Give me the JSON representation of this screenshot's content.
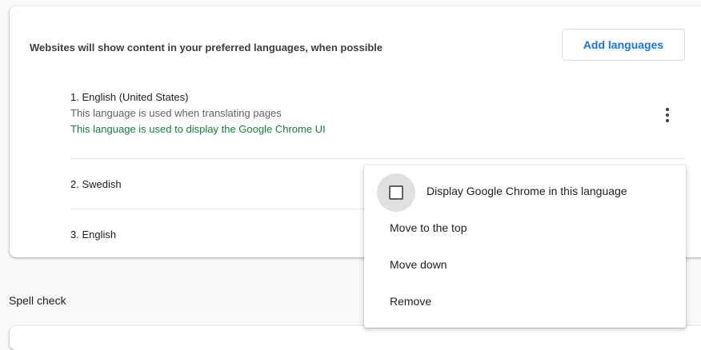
{
  "languages_card": {
    "header": "Websites will show content in your preferred languages, when possible",
    "add_button_label": "Add languages",
    "languages": [
      {
        "name": "1. English (United States)",
        "note": "This language is used when translating pages",
        "ui_note": "This language is used to display the Google Chrome UI"
      },
      {
        "name": "2. Swedish"
      },
      {
        "name": "3. English"
      }
    ]
  },
  "context_menu": {
    "checkbox_label": "Display Google Chrome in this language",
    "checkbox_checked": false,
    "items": [
      "Move to the top",
      "Move down",
      "Remove"
    ]
  },
  "spell_check": {
    "title": "Spell check"
  },
  "icons": {
    "more": "more-vert-icon",
    "checkbox": "checkbox-unchecked-icon"
  },
  "colors": {
    "accent": "#1a73e8",
    "green_note": "#188038",
    "background": "#f8f9fa"
  }
}
